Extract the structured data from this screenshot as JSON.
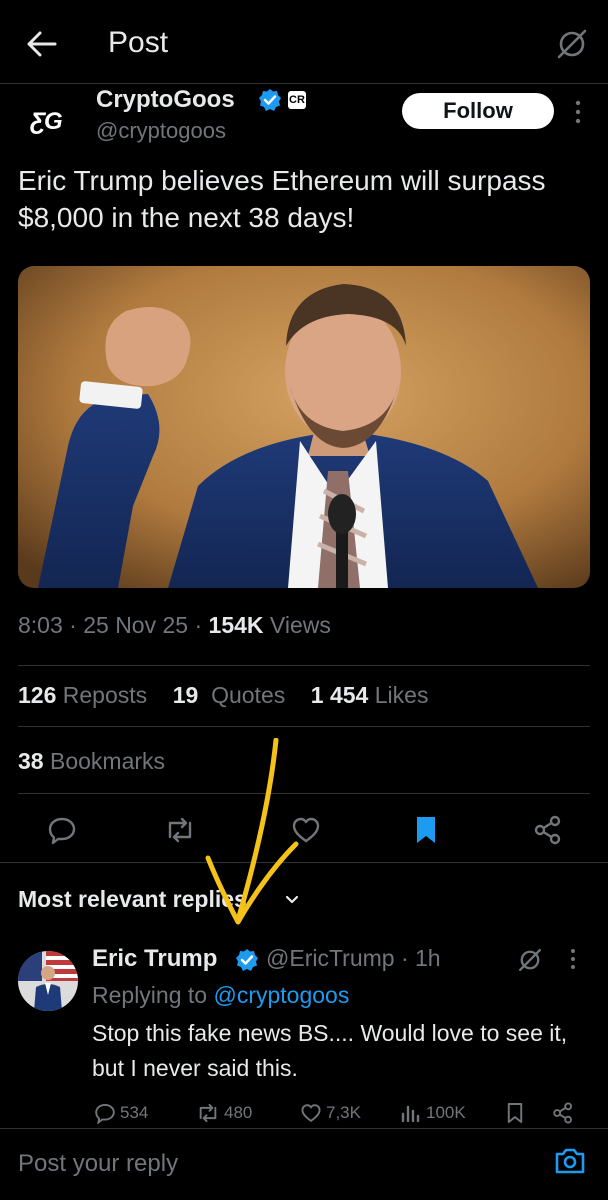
{
  "header": {
    "title": "Post"
  },
  "author": {
    "avatar_text": "ƸG",
    "name": "CryptoGoos",
    "handle": "@cryptogoos",
    "affiliate_badge": "CR"
  },
  "follow_label": "Follow",
  "tweet": {
    "text": "Eric Trump believes Ethereum will surpass $8,000 in the next 38 days!"
  },
  "meta": {
    "time": "8:03",
    "date": "25 Nov 25",
    "views_count": "154K",
    "views_label": "Views"
  },
  "stats": {
    "reposts_count": "126",
    "reposts_label": "Reposts",
    "quotes_count": "19",
    "quotes_label": "Quotes",
    "likes_count": "1 454",
    "likes_label": "Likes"
  },
  "bookmarks": {
    "count": "38",
    "label": "Bookmarks"
  },
  "replies_sort": {
    "label": "Most relevant replies"
  },
  "reply": {
    "name": "Eric Trump",
    "handle": "@EricTrump",
    "time": "1h",
    "replying_prefix": "Replying to",
    "replying_to": "@cryptogoos",
    "text": "Stop this fake news BS.... Would love to see it, but I never said this.",
    "replies": "534",
    "reposts": "480",
    "likes": "7,3K",
    "views": "100K"
  },
  "composer": {
    "placeholder": "Post your reply"
  },
  "colors": {
    "background": "#000000",
    "text": "#e7e9ea",
    "muted": "#71767b",
    "accent": "#1d9bf0",
    "divider": "#2f3336",
    "annotation": "#f5c21a"
  },
  "icons": [
    "back-arrow-icon",
    "grok-icon",
    "verified-badge-icon",
    "more-icon",
    "reply-icon",
    "repost-icon",
    "like-icon",
    "bookmark-icon",
    "share-icon",
    "chevron-down-icon",
    "views-icon",
    "camera-icon"
  ]
}
